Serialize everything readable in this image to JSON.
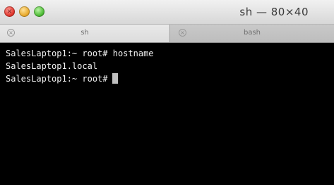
{
  "window": {
    "title": "sh — 80×40",
    "controls": [
      {
        "name": "close",
        "color": "#e0352b",
        "glyph": "×"
      },
      {
        "name": "minimize",
        "color": "#e8a92c",
        "glyph": ""
      },
      {
        "name": "zoom",
        "color": "#4dbb35",
        "glyph": ""
      }
    ]
  },
  "tabs": [
    {
      "label": "sh",
      "active": true,
      "close_icon": "close-icon"
    },
    {
      "label": "bash",
      "active": false,
      "close_icon": "close-icon"
    }
  ],
  "terminal": {
    "lines": [
      {
        "prompt": "SalesLaptop1:~ root#",
        "command": "hostname"
      },
      {
        "output": "SalesLaptop1.local"
      },
      {
        "prompt": "SalesLaptop1:~ root#",
        "command": ""
      }
    ],
    "cursor_color": "#bfbfbf",
    "background": "#000000",
    "foreground": "#f2f2f2"
  }
}
